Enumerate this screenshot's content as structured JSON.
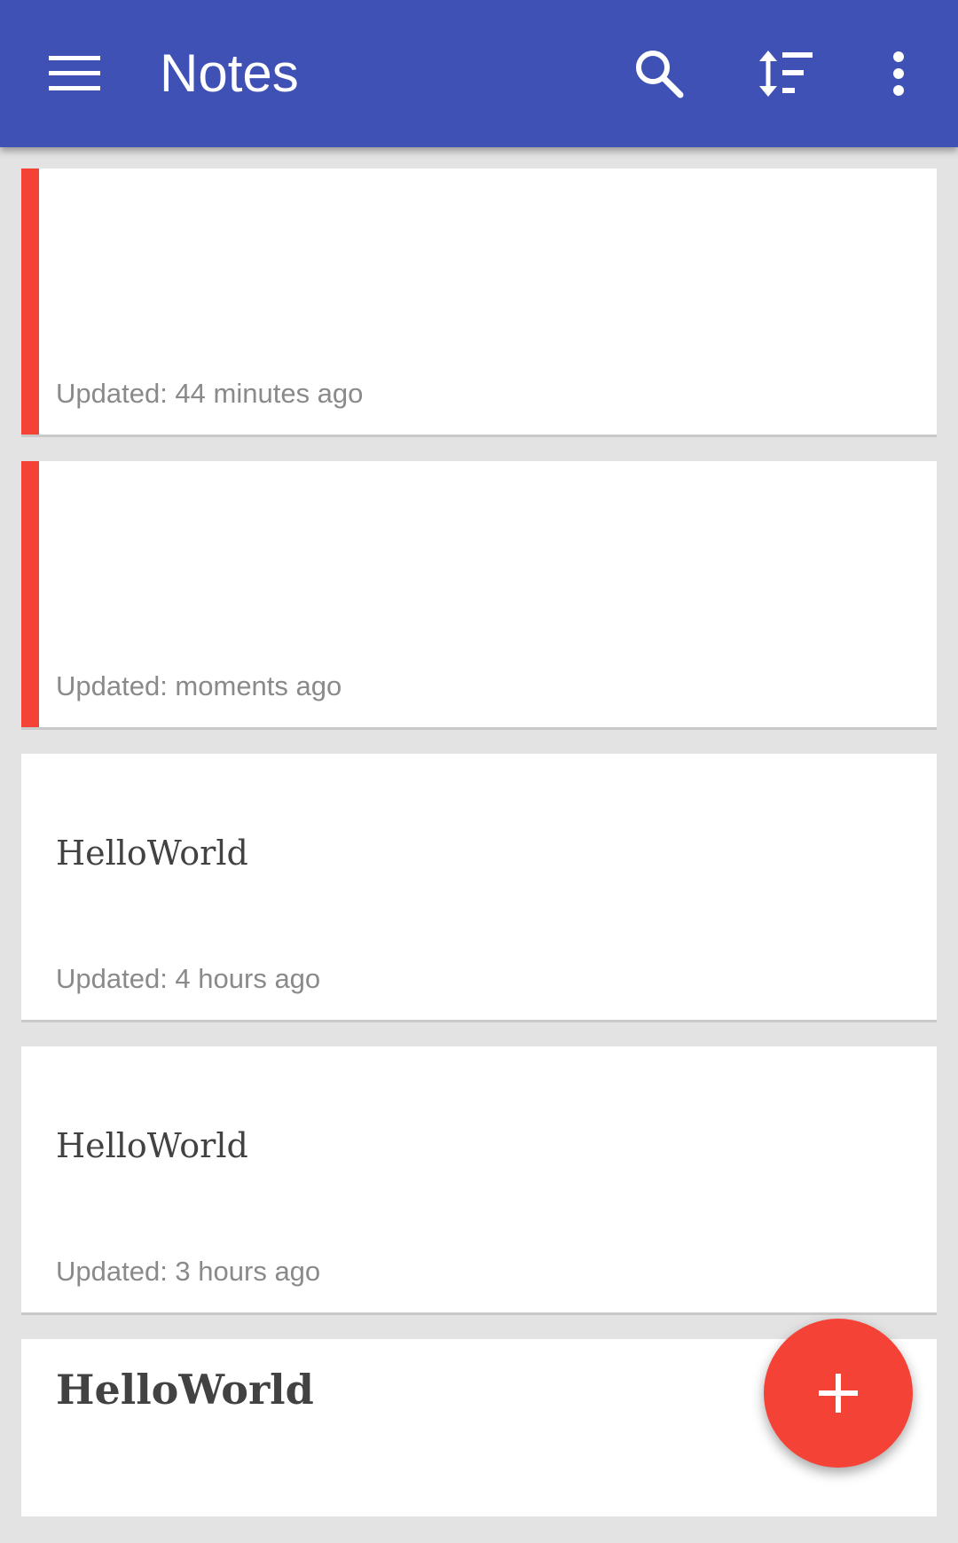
{
  "app_bar": {
    "title": "Notes",
    "icons": [
      "menu-icon",
      "search-icon",
      "sort-icon",
      "more-vert-icon"
    ],
    "background": "#3f51b5"
  },
  "notes": [
    {
      "title": "",
      "updated": "Updated: 44 minutes ago",
      "color_bar": "#f44336"
    },
    {
      "title": "",
      "updated": "Updated: moments ago",
      "color_bar": "#f44336"
    },
    {
      "title": "HelloWorld",
      "updated": "Updated: 4 hours ago",
      "color_bar": ""
    },
    {
      "title": "HelloWorld",
      "updated": "Updated: 3 hours ago",
      "color_bar": ""
    },
    {
      "title": "HelloWorld",
      "updated": "",
      "color_bar": ""
    }
  ],
  "fab": {
    "icon": "add-icon",
    "color": "#f44336"
  },
  "colors": {
    "accent": "#f44336",
    "primary": "#3f51b5",
    "background": "#e3e3e3"
  }
}
